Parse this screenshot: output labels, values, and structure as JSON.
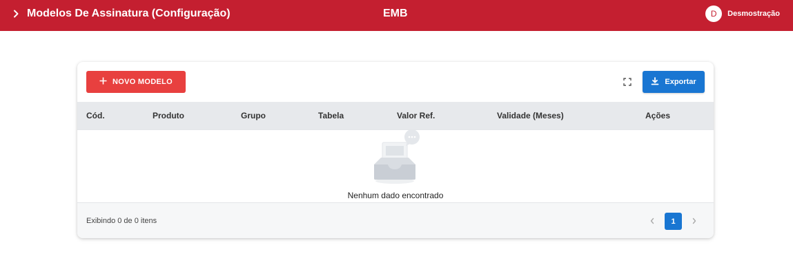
{
  "header": {
    "title": "Modelos De Assinatura (Configuração)",
    "center_label": "EMB",
    "user_initial": "D",
    "user_name": "Desmostração",
    "color": "#c41f30"
  },
  "toolbar": {
    "new_label": "NOVO MODELO",
    "new_icon": "plus-icon",
    "fullscreen_icon": "fullscreen-icon",
    "export_label": "Exportar",
    "export_icon": "download-icon",
    "new_color": "#e8403f",
    "export_color": "#1976d2"
  },
  "table": {
    "columns": [
      "Cód.",
      "Produto",
      "Grupo",
      "Tabela",
      "Valor Ref.",
      "Validade (Meses)",
      "Ações"
    ],
    "rows": [],
    "empty_icon": "empty-inbox-icon",
    "empty_text": "Nenhum dado encontrado"
  },
  "footer": {
    "count_text": "Exibindo 0 de 0 itens",
    "current_page": "1",
    "prev_icon": "chevron-left-icon",
    "next_icon": "chevron-right-icon"
  }
}
